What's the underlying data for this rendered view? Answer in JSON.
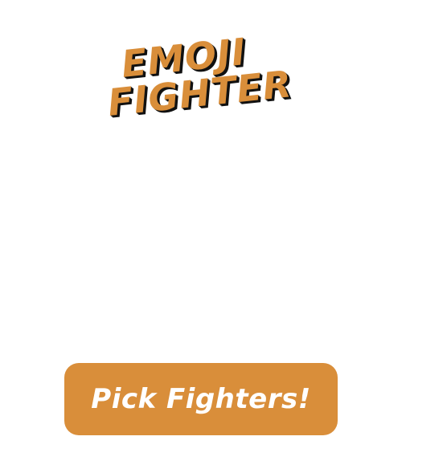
{
  "logo": {
    "line1": "Emoji",
    "line2": "Fighter"
  },
  "actions": {
    "pick_fighters_label": "Pick Fighters!"
  },
  "colors": {
    "accent": "#d98e3a",
    "text_on_accent": "#ffffff",
    "logo_shadow": "#111111",
    "background": "#ffffff"
  }
}
